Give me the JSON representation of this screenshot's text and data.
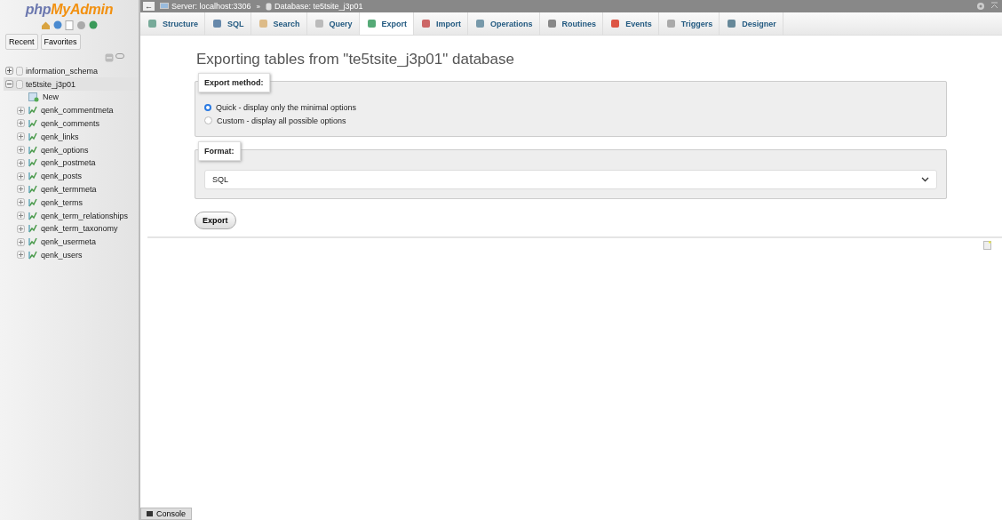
{
  "logo": {
    "prefix": "php",
    "name": "MyAdmin"
  },
  "sidebar_tabs": [
    {
      "label": "Recent"
    },
    {
      "label": "Favorites"
    }
  ],
  "databases": [
    {
      "name": "information_schema",
      "expanded": false,
      "selected": false
    },
    {
      "name": "te5tsite_j3p01",
      "expanded": true,
      "selected": true,
      "children": [
        {
          "name": "New",
          "kind": "new"
        },
        {
          "name": "qenk_commentmeta",
          "kind": "table"
        },
        {
          "name": "qenk_comments",
          "kind": "table"
        },
        {
          "name": "qenk_links",
          "kind": "table"
        },
        {
          "name": "qenk_options",
          "kind": "table"
        },
        {
          "name": "qenk_postmeta",
          "kind": "table"
        },
        {
          "name": "qenk_posts",
          "kind": "table"
        },
        {
          "name": "qenk_termmeta",
          "kind": "table"
        },
        {
          "name": "qenk_terms",
          "kind": "table"
        },
        {
          "name": "qenk_term_relationships",
          "kind": "table"
        },
        {
          "name": "qenk_term_taxonomy",
          "kind": "table"
        },
        {
          "name": "qenk_usermeta",
          "kind": "table"
        },
        {
          "name": "qenk_users",
          "kind": "table"
        }
      ]
    }
  ],
  "breadcrumb": [
    {
      "label": "Server: localhost:3306",
      "kind": "server"
    },
    {
      "label": "Database: te5tsite_j3p01",
      "kind": "database"
    }
  ],
  "breadcrumb_separator": "»",
  "back": "←",
  "tabs": [
    {
      "label": "Structure",
      "selected": false
    },
    {
      "label": "SQL",
      "selected": false
    },
    {
      "label": "Search",
      "selected": false
    },
    {
      "label": "Query",
      "selected": false
    },
    {
      "label": "Export",
      "selected": true
    },
    {
      "label": "Import",
      "selected": false
    },
    {
      "label": "Operations",
      "selected": false
    },
    {
      "label": "Routines",
      "selected": false
    },
    {
      "label": "Events",
      "selected": false
    },
    {
      "label": "Triggers",
      "selected": false
    },
    {
      "label": "Designer",
      "selected": false
    }
  ],
  "heading": "Exporting tables from \"te5tsite_j3p01\" database",
  "export_method": {
    "legend": "Export method:",
    "options": [
      {
        "label": "Quick - display only the minimal options",
        "selected": true
      },
      {
        "label": "Custom - display all possible options",
        "selected": false
      }
    ]
  },
  "format": {
    "legend": "Format:",
    "value": "SQL"
  },
  "export_button": "Export",
  "console": "Console"
}
